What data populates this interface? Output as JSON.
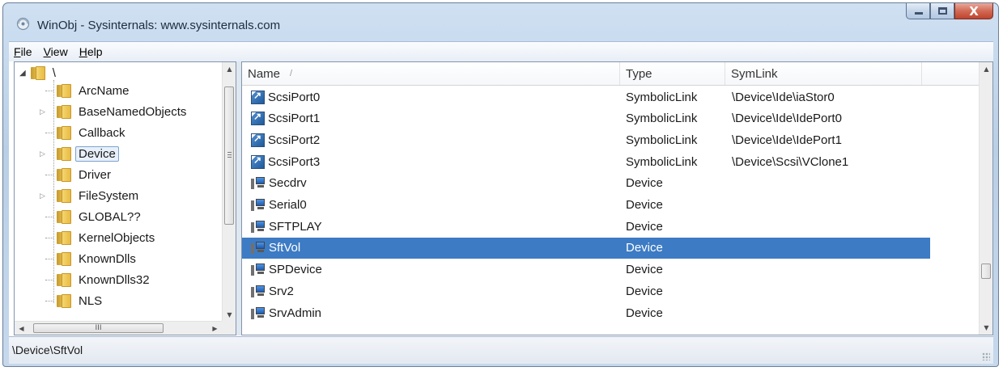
{
  "window": {
    "title": "WinObj - Sysinternals: www.sysinternals.com",
    "minimize_glyph": "",
    "maximize_glyph": "",
    "close_glyph": "X"
  },
  "menu": {
    "items": [
      {
        "hotkey": "F",
        "rest": "ile"
      },
      {
        "hotkey": "V",
        "rest": "iew"
      },
      {
        "hotkey": "H",
        "rest": "elp"
      }
    ]
  },
  "tree": {
    "root": "\\",
    "items": [
      {
        "label": "ArcName",
        "expandable": false
      },
      {
        "label": "BaseNamedObjects",
        "expandable": true
      },
      {
        "label": "Callback",
        "expandable": false
      },
      {
        "label": "Device",
        "expandable": true,
        "selected": true
      },
      {
        "label": "Driver",
        "expandable": false
      },
      {
        "label": "FileSystem",
        "expandable": true
      },
      {
        "label": "GLOBAL??",
        "expandable": false
      },
      {
        "label": "KernelObjects",
        "expandable": false
      },
      {
        "label": "KnownDlls",
        "expandable": false
      },
      {
        "label": "KnownDlls32",
        "expandable": false
      },
      {
        "label": "NLS",
        "expandable": false
      }
    ],
    "hscroll_thumb": "III"
  },
  "list": {
    "columns": {
      "name": "Name",
      "sort_mark": "/",
      "type": "Type",
      "symlink": "SymLink"
    },
    "rows": [
      {
        "name": "ScsiPort0",
        "type": "SymbolicLink",
        "symlink": "\\Device\\Ide\\iaStor0",
        "icon": "symlink-icon"
      },
      {
        "name": "ScsiPort1",
        "type": "SymbolicLink",
        "symlink": "\\Device\\Ide\\IdePort0",
        "icon": "symlink-icon"
      },
      {
        "name": "ScsiPort2",
        "type": "SymbolicLink",
        "symlink": "\\Device\\Ide\\IdePort1",
        "icon": "symlink-icon"
      },
      {
        "name": "ScsiPort3",
        "type": "SymbolicLink",
        "symlink": "\\Device\\Scsi\\VClone1",
        "icon": "symlink-icon"
      },
      {
        "name": "Secdrv",
        "type": "Device",
        "symlink": "",
        "icon": "device-icon"
      },
      {
        "name": "Serial0",
        "type": "Device",
        "symlink": "",
        "icon": "device-icon"
      },
      {
        "name": "SFTPLAY",
        "type": "Device",
        "symlink": "",
        "icon": "device-icon"
      },
      {
        "name": "SftVol",
        "type": "Device",
        "symlink": "",
        "icon": "device-icon",
        "selected": true
      },
      {
        "name": "SPDevice",
        "type": "Device",
        "symlink": "",
        "icon": "device-icon"
      },
      {
        "name": "Srv2",
        "type": "Device",
        "symlink": "",
        "icon": "device-icon"
      },
      {
        "name": "SrvAdmin",
        "type": "Device",
        "symlink": "",
        "icon": "device-icon"
      }
    ]
  },
  "status": {
    "path": "\\Device\\SftVol"
  },
  "colors": {
    "selection": "#3d7bc4",
    "title_gradient": "#c6d8ec",
    "close_button": "#c0442d"
  }
}
